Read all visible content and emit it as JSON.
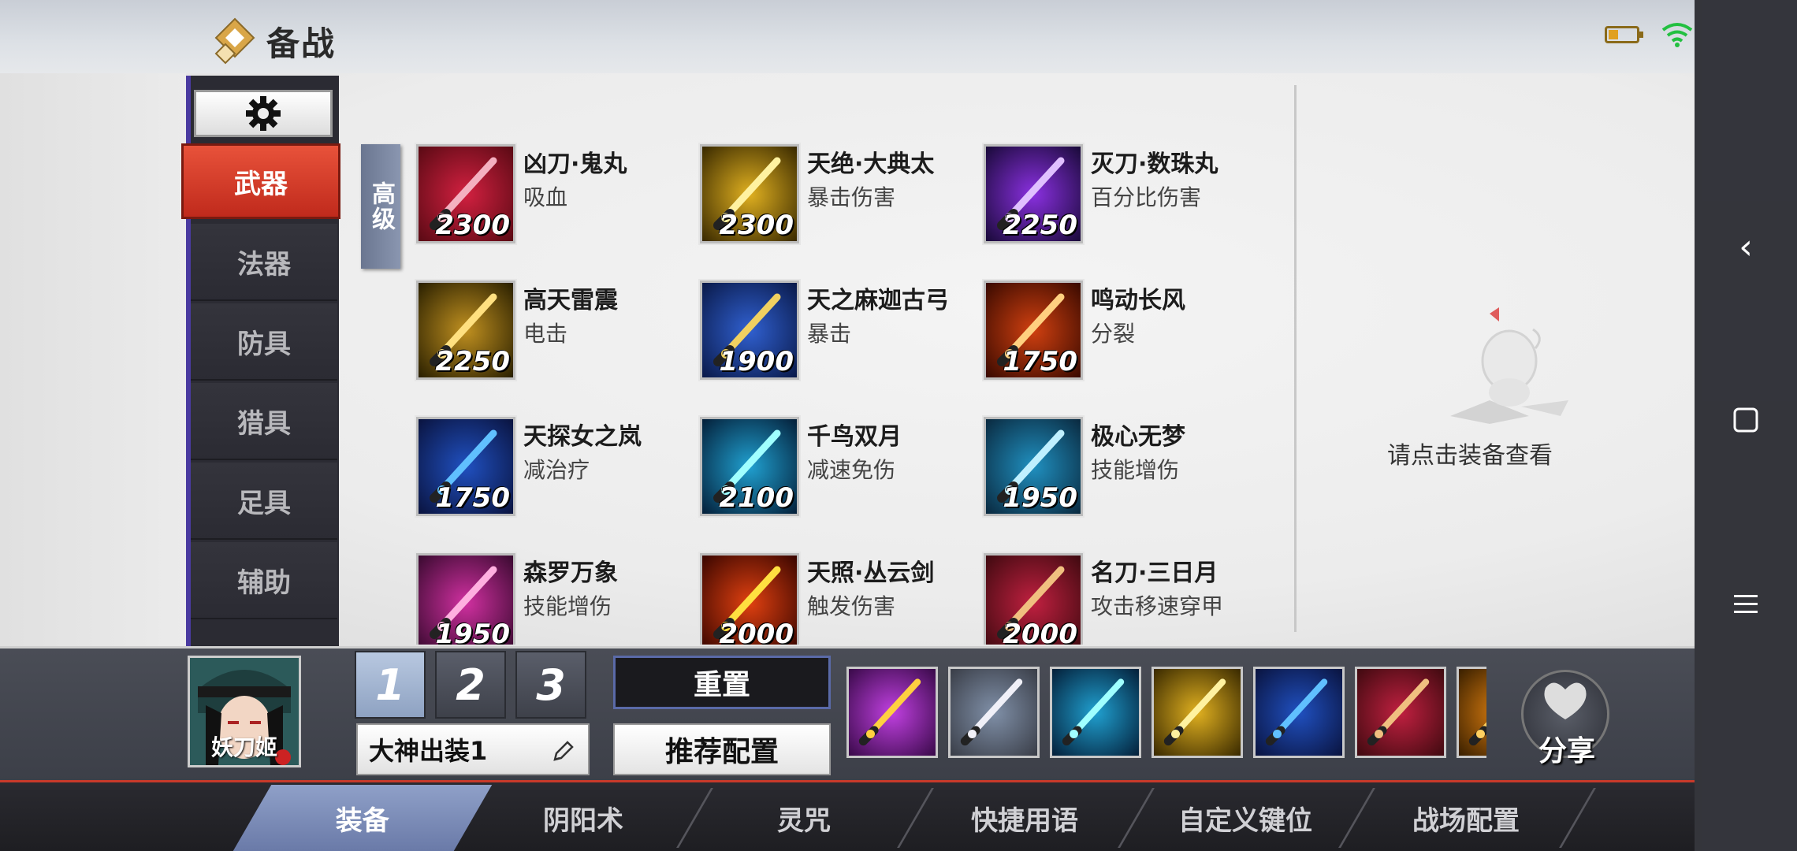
{
  "header": {
    "title": "备战"
  },
  "side_menu": {
    "items": [
      {
        "label": "武器",
        "active": true
      },
      {
        "label": "法器",
        "active": false
      },
      {
        "label": "防具",
        "active": false
      },
      {
        "label": "猎具",
        "active": false
      },
      {
        "label": "足具",
        "active": false
      },
      {
        "label": "辅助",
        "active": false
      }
    ]
  },
  "filter": {
    "grade_label": "高级"
  },
  "items": [
    {
      "name": "凶刀·鬼丸",
      "attr": "吸血",
      "price": "2300",
      "icon": "katana-sakura-icon"
    },
    {
      "name": "天绝·大典太",
      "attr": "暴击伤害",
      "price": "2300",
      "icon": "golden-katana-icon"
    },
    {
      "name": "灭刀·数珠丸",
      "attr": "百分比伤害",
      "price": "2250",
      "icon": "purple-katana-icon"
    },
    {
      "name": "高天雷震",
      "attr": "电击",
      "price": "2250",
      "icon": "thunder-gauntlet-icon"
    },
    {
      "name": "天之麻迦古弓",
      "attr": "暴击",
      "price": "1900",
      "icon": "divine-bow-icon"
    },
    {
      "name": "鸣动长风",
      "attr": "分裂",
      "price": "1750",
      "icon": "wind-blade-icon"
    },
    {
      "name": "天探女之岚",
      "attr": "减治疗",
      "price": "1750",
      "icon": "storm-bow-icon"
    },
    {
      "name": "千鸟双月",
      "attr": "减速免伤",
      "price": "2100",
      "icon": "twin-blades-icon"
    },
    {
      "name": "极心无梦",
      "attr": "技能增伤",
      "price": "1950",
      "icon": "chain-sickle-icon"
    },
    {
      "name": "森罗万象",
      "attr": "技能增伤",
      "price": "1950",
      "icon": "pink-scythe-icon"
    },
    {
      "name": "天照·丛云剑",
      "attr": "触发伤害",
      "price": "2000",
      "icon": "flame-sword-icon"
    },
    {
      "name": "名刀·三日月",
      "attr": "攻击移速穿甲",
      "price": "2000",
      "icon": "crescent-katana-icon"
    }
  ],
  "detail": {
    "hint": "请点击装备查看"
  },
  "loadout": {
    "character_name": "妖刀姬",
    "slots": [
      "1",
      "2",
      "3"
    ],
    "active_slot": "1",
    "name": "大神出装1",
    "reset_label": "重置",
    "recommend_label": "推荐配置",
    "equipped": [
      "purple-eye-icon",
      "white-boots-icon",
      "twin-blades-icon",
      "golden-katana-icon",
      "storm-bow-icon",
      "crescent-katana-icon",
      "gold-item-icon"
    ],
    "share_label": "分享"
  },
  "tabs": [
    {
      "label": "装备",
      "active": true
    },
    {
      "label": "阴阳术",
      "active": false
    },
    {
      "label": "灵咒",
      "active": false
    },
    {
      "label": "快捷用语",
      "active": false
    },
    {
      "label": "自定义键位",
      "active": false
    },
    {
      "label": "战场配置",
      "active": false
    }
  ],
  "colors": {
    "accent_red": "#d63a28",
    "tab_active": "#7a8ab8",
    "panel_dark": "#2b2b33"
  }
}
